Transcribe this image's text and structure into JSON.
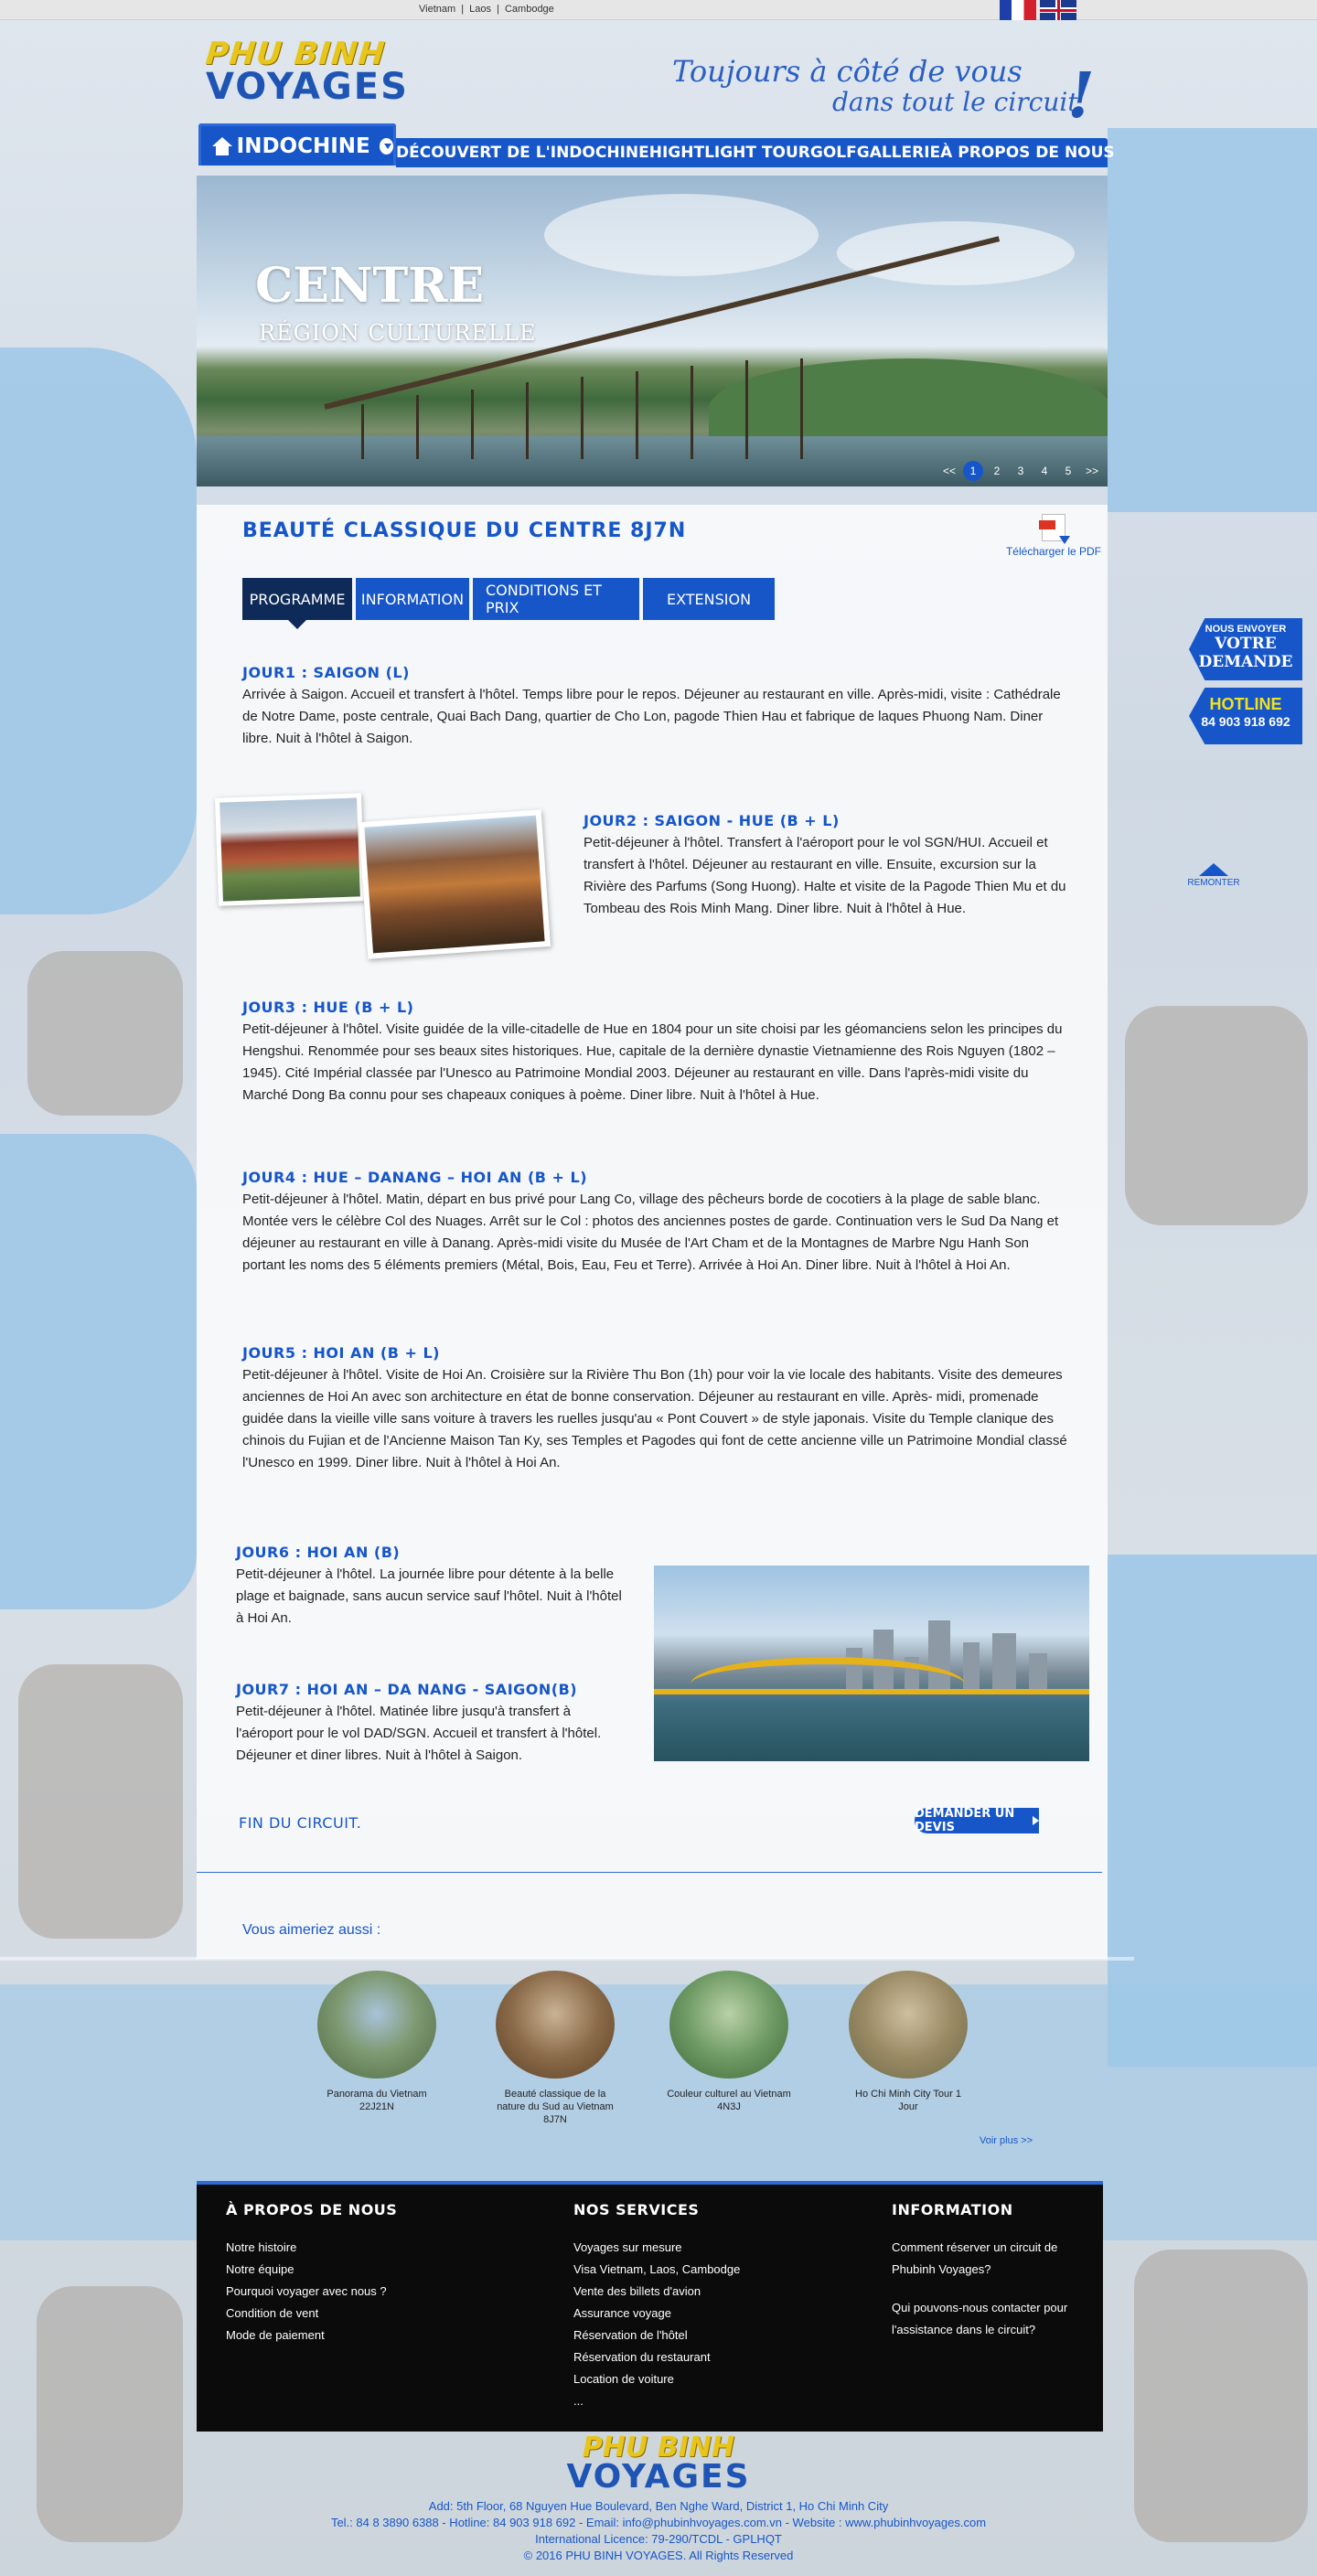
{
  "topbar": {
    "links": [
      "Vietnam",
      "Laos",
      "Cambodge"
    ],
    "separator": "|"
  },
  "brand": {
    "line1": "PHU BINH",
    "line2": "VOYAGES"
  },
  "tagline": {
    "line1": "Toujours à côté de vous",
    "line2": "dans tout le circuit",
    "mark": "!"
  },
  "nav": {
    "home": "INDOCHINE",
    "items": [
      "DÉCOUVERT DE L'INDOCHINE",
      "HIGHTLIGHT TOUR",
      "GOLF",
      "GALLERIE",
      "À PROPOS DE NOUS"
    ]
  },
  "slider": {
    "title": "CENTRE",
    "subtitle": "RÉGION CULTURELLE",
    "pager": {
      "prev": "<<",
      "pages": [
        "1",
        "2",
        "3",
        "4",
        "5"
      ],
      "next": ">>",
      "active": "1"
    }
  },
  "tour": {
    "title": "BEAUTÉ CLASSIQUE DU CENTRE 8J7N",
    "pdf_label": "Télécharger le PDF",
    "tabs": [
      "PROGRAMME",
      "INFORMATION",
      "CONDITIONS ET PRIX",
      "EXTENSION"
    ],
    "days": [
      {
        "title": "JOUR1 : SAIGON (L)",
        "text": "Arrivée à Saigon. Accueil et transfert à l'hôtel. Temps libre pour le repos. Déjeuner au restaurant en ville. Après-midi, visite : Cathédrale de Notre Dame, poste centrale, Quai Bach Dang, quartier de Cho Lon, pagode Thien Hau et fabrique de laques Phuong Nam. Diner libre. Nuit à l'hôtel à Saigon."
      },
      {
        "title": "JOUR2 : SAIGON -  HUE (B + L)",
        "text": "Petit-déjeuner à l'hôtel. Transfert à l'aéroport pour le vol SGN/HUI. Accueil et transfert à l'hôtel. Déjeuner au restaurant en ville. Ensuite, excursion sur la Rivière des Parfums (Song Huong). Halte et visite de la Pagode Thien Mu et du Tombeau des Rois Minh Mang. Diner libre. Nuit à l'hôtel à Hue."
      },
      {
        "title": "JOUR3 : HUE (B + L)",
        "text": "Petit-déjeuner à l'hôtel. Visite guidée de la ville-citadelle de Hue en 1804 pour un site choisi par les géomanciens selon les principes du Hengshui. Renommée pour ses beaux sites historiques. Hue, capitale de la dernière dynastie Vietnamienne des Rois Nguyen (1802 – 1945). Cité Impérial classée par l'Unesco au Patrimoine Mondial 2003. Déjeuner au restaurant en ville. Dans l'après-midi visite du Marché Dong Ba connu pour ses chapeaux coniques à poème. Diner libre. Nuit à l'hôtel à Hue."
      },
      {
        "title": "JOUR4 : HUE – DANANG – HOI AN (B + L)",
        "text": "Petit-déjeuner à l'hôtel. Matin, départ en bus privé pour Lang Co, village des pêcheurs borde de cocotiers à la plage de sable blanc. Montée vers le célèbre Col des Nuages. Arrêt sur le Col : photos des anciennes postes de garde. Continuation vers le Sud Da Nang et déjeuner au restaurant en ville à Danang. Après-midi visite du Musée de l'Art Cham et de la Montagnes de Marbre Ngu Hanh Son portant les noms des 5 éléments premiers (Métal, Bois, Eau, Feu et Terre). Arrivée à Hoi An. Diner libre. Nuit à l'hôtel à Hoi An."
      },
      {
        "title": "JOUR5 : HOI AN (B + L)",
        "text": "Petit-déjeuner à l'hôtel. Visite de Hoi An. Croisière sur la Rivière Thu Bon (1h) pour voir la vie locale des habitants. Visite des demeures anciennes de Hoi An avec son architecture en état de bonne conservation. Déjeuner au restaurant en ville. Après- midi, promenade guidée dans la vieille ville sans voiture à travers les ruelles jusqu'au « Pont Couvert » de style japonais. Visite du Temple clanique des chinois du Fujian et de l'Ancienne Maison Tan Ky, ses Temples et Pagodes qui font de cette ancienne ville un Patrimoine Mondial classé l'Unesco en 1999. Diner libre. Nuit à l'hôtel à Hoi An."
      },
      {
        "title": "JOUR6 : HOI AN (B)",
        "text": "Petit-déjeuner à l'hôtel. La journée libre pour détente à la belle plage et baignade, sans aucun service sauf l'hôtel. Nuit à l'hôtel à Hoi An."
      },
      {
        "title": "JOUR7 : HOI AN – DA NANG - SAIGON(B)",
        "text": "Petit-déjeuner à l'hôtel. Matinée libre jusqu'à transfert à l'aéroport pour le vol DAD/SGN. Accueil et transfert à l'hôtel. Déjeuner et diner libres. Nuit à l'hôtel à Saigon."
      }
    ],
    "end_label": "FIN DU CIRCUIT.",
    "quote_button": "DEMANDER UN DEVIS"
  },
  "related": {
    "heading": "Vous aimeriez aussi :",
    "items": [
      {
        "label": "Panorama du Vietnam 22J21N",
        "color": "#6f8c5a"
      },
      {
        "label": "Beauté classique de la nature du Sud au Vietnam 8J7N",
        "color": "#7a5a3a"
      },
      {
        "label": "Couleur culturel au Vietnam 4N3J",
        "color": "#5f8a62"
      },
      {
        "label": "Ho Chi Minh City Tour 1 Jour",
        "color": "#8a7a5a"
      }
    ],
    "more": "Voir plus >>"
  },
  "footer": {
    "about": {
      "title": "À PROPOS DE NOUS",
      "links": [
        "Notre histoire",
        "Notre équipe",
        "Pourquoi voyager avec nous ?",
        "Condition de vent",
        "Mode de paiement"
      ]
    },
    "services": {
      "title": "NOS SERVICES",
      "links": [
        "Voyages sur mesure",
        "Visa Vietnam, Laos, Cambodge",
        "Vente des billets d'avion",
        "Assurance voyage",
        "Réservation de l'hôtel",
        "Réservation du restaurant",
        "Location de voiture",
        "..."
      ]
    },
    "info": {
      "title": "INFORMATION",
      "links": [
        "Comment réserver un circuit de Phubinh Voyages?",
        "Qui pouvons-nous contacter pour l'assistance dans le circuit?"
      ]
    }
  },
  "bottom": {
    "address": "Add: 5th Floor, 68 Nguyen Hue Boulevard, Ben Nghe Ward, District 1, Ho Chi Minh City",
    "contacts": "Tel.: 84 8 3890 6388  -  Hotline: 84 903 918 692 - Email: info@phubinhvoyages.com.vn - Website : www.phubinhvoyages.com",
    "licence": "International Licence: 79-290/TCDL - GPLHQT",
    "copyright": "© 2016 PHU BINH VOYAGES. All Rights Reserved"
  },
  "side": {
    "demand_line1": "NOUS ENVOYER",
    "demand_line2": "VOTRE",
    "demand_line3": "DEMANDE",
    "hotline_label": "HOTLINE",
    "hotline_number": "84 903 918 692",
    "back_to_top": "REMONTER"
  }
}
